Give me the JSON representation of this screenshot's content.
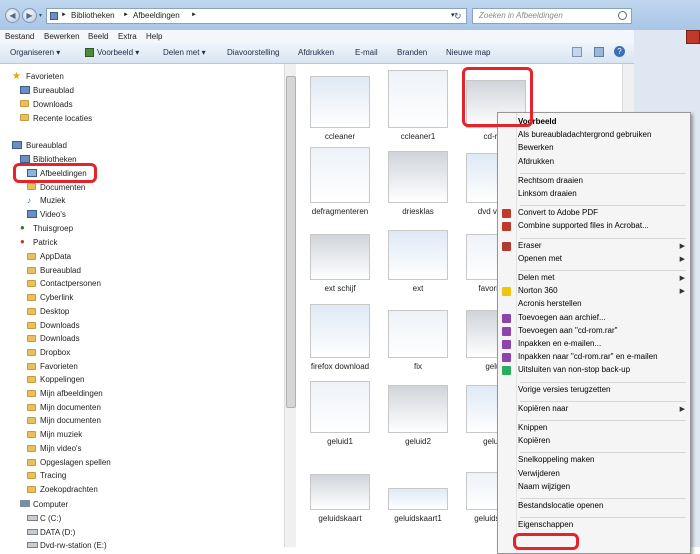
{
  "address": {
    "crumb1": "Bibliotheken",
    "crumb2": "Afbeeldingen",
    "sep": "►",
    "search_placeholder": "Zoeken in Afbeeldingen"
  },
  "menubar": [
    "Bestand",
    "Bewerken",
    "Beeld",
    "Extra",
    "Help"
  ],
  "toolbar": [
    "Organiseren ▾",
    "Voorbeeld ▾",
    "Delen met ▾",
    "Diavoorstelling",
    "Afdrukken",
    "E-mail",
    "Branden",
    "Nieuwe map"
  ],
  "nav": {
    "favorites": "Favorieten",
    "bureaublad": "Bureaublad",
    "downloads": "Downloads",
    "recent": "Recente locaties",
    "desktop_root": "Bureaublad",
    "bibliotheken": "Bibliotheken",
    "afbeeldingen": "Afbeeldingen",
    "documenten": "Documenten",
    "muziek": "Muziek",
    "videos": "Video's",
    "thuisgroep": "Thuisgroep",
    "patrick": "Patrick",
    "patrick_items": [
      "AppData",
      "Bureaublad",
      "Contactpersonen",
      "Cyberlink",
      "Desktop",
      "Downloads",
      "Downloads",
      "Dropbox",
      "Favorieten",
      "Koppelingen",
      "Mijn afbeeldingen",
      "Mijn documenten",
      "Mijn documenten",
      "Mijn muziek",
      "Mijn video's",
      "Opgeslagen spellen",
      "Tracing",
      "Zoekopdrachten"
    ],
    "computer": "Computer",
    "drives": [
      "C (C:)",
      "DATA (D:)",
      "Dvd-rw-station (E:)"
    ]
  },
  "files": [
    "ccleaner",
    "ccleaner1",
    "cd-rom",
    "defragmenteren",
    "driesklas",
    "dvd versie",
    "ext schijf",
    "ext",
    "favorieten",
    "firefox download",
    "fix",
    "geluid",
    "geluid1",
    "geluid2",
    "geluid3",
    "geluidskaart",
    "geluidskaart1",
    "geluidspoort"
  ],
  "context_menu": [
    {
      "label": "Voorbeeld",
      "bold": true
    },
    {
      "label": "Als bureaubladachtergrond gebruiken"
    },
    {
      "label": "Bewerken"
    },
    {
      "label": "Afdrukken"
    },
    {
      "sep": true
    },
    {
      "label": "Rechtsom draaien"
    },
    {
      "label": "Linksom draaien"
    },
    {
      "sep": true
    },
    {
      "label": "Convert to Adobe PDF",
      "icon": "#c0392b"
    },
    {
      "label": "Combine supported files in Acrobat...",
      "icon": "#c0392b"
    },
    {
      "sep": true
    },
    {
      "label": "Eraser",
      "icon": "#b03a2e",
      "submenu": true
    },
    {
      "label": "Openen met",
      "submenu": true
    },
    {
      "sep": true
    },
    {
      "label": "Delen met",
      "submenu": true
    },
    {
      "label": "Norton 360",
      "icon": "#f1c40f",
      "submenu": true
    },
    {
      "label": "Acronis herstellen"
    },
    {
      "label": "Toevoegen aan archief...",
      "icon": "#8e44ad"
    },
    {
      "label": "Toevoegen aan \"cd-rom.rar\"",
      "icon": "#8e44ad"
    },
    {
      "label": "Inpakken en e-mailen...",
      "icon": "#8e44ad"
    },
    {
      "label": "Inpakken naar \"cd-rom.rar\" en e-mailen",
      "icon": "#8e44ad"
    },
    {
      "label": "Uitsluiten van non-stop back-up",
      "icon": "#27ae60"
    },
    {
      "sep": true
    },
    {
      "label": "Vorige versies terugzetten"
    },
    {
      "sep": true
    },
    {
      "label": "Kopiëren naar",
      "submenu": true
    },
    {
      "sep": true
    },
    {
      "label": "Knippen"
    },
    {
      "label": "Kopiëren"
    },
    {
      "sep": true
    },
    {
      "label": "Snelkoppeling maken"
    },
    {
      "label": "Verwijderen"
    },
    {
      "label": "Naam wijzigen"
    },
    {
      "sep": true
    },
    {
      "label": "Bestandslocatie openen"
    },
    {
      "sep": true
    },
    {
      "label": "Eigenschappen"
    }
  ],
  "colors": {
    "highlight": "#e3242b",
    "accent": "#3b6fb6"
  }
}
